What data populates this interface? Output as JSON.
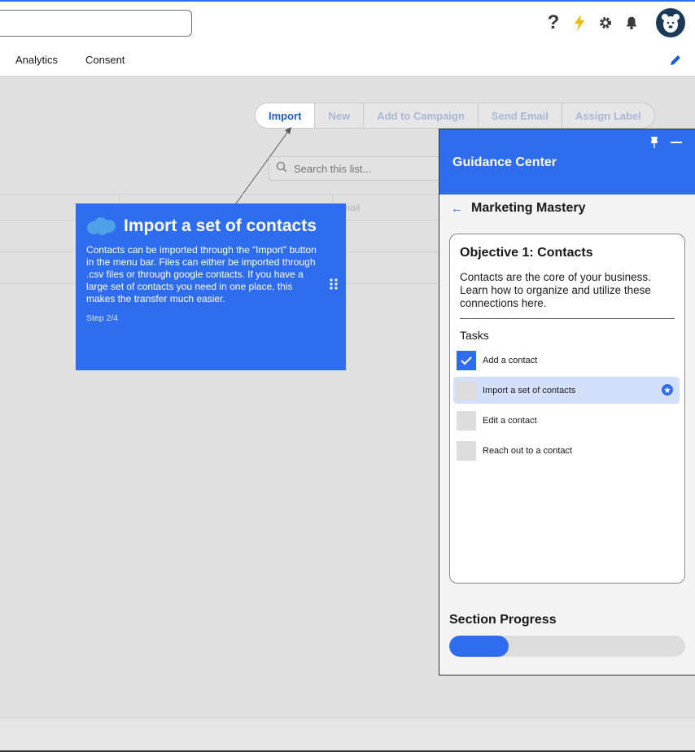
{
  "nav": {
    "items": [
      "Analytics",
      "Consent"
    ]
  },
  "toolbar": {
    "buttons": [
      "Import",
      "New",
      "Add to Campaign",
      "Send Email",
      "Assign Label"
    ]
  },
  "list": {
    "search_placeholder": "Search this list...",
    "email_header": "mail"
  },
  "tour": {
    "title": "Import a set of contacts",
    "body": "Contacts can be imported through the “Import” button in the menu bar. Files can either be imported through .csv files or through google contacts. If you have a large set of contacts you need in one place, this makes the transfer much easier.",
    "step": "Step 2/4"
  },
  "guidance": {
    "title": "Guidance Center",
    "section": "Marketing Mastery",
    "objective_title": "Objective 1: Contacts",
    "objective_desc": "Contacts are the core of your business. Learn how to organize and utilize these connections here.",
    "tasks_label": "Tasks",
    "tasks": [
      {
        "label": "Add a contact",
        "done": true,
        "active": false
      },
      {
        "label": "Import a set of contacts",
        "done": false,
        "active": true
      },
      {
        "label": "Edit a contact",
        "done": false,
        "active": false
      },
      {
        "label": "Reach out to a contact",
        "done": false,
        "active": false
      }
    ],
    "progress_label": "Section Progress",
    "progress_fraction": 0.25
  },
  "icons": {
    "help": "help-icon",
    "lightning": "lightning-icon",
    "settings": "gear-icon",
    "notifications": "bell-icon",
    "edit": "pencil-icon",
    "search": "search-icon",
    "pin": "pin-icon",
    "minimize": "minimize-icon",
    "back": "arrow-left-icon",
    "check": "check-icon",
    "star": "star-icon",
    "drag": "drag-handle-icon",
    "cloud": "cloud-icon"
  },
  "colors": {
    "accent": "#2f6df0",
    "lightning": "#f2b705",
    "avatar": "#1b3a57"
  }
}
